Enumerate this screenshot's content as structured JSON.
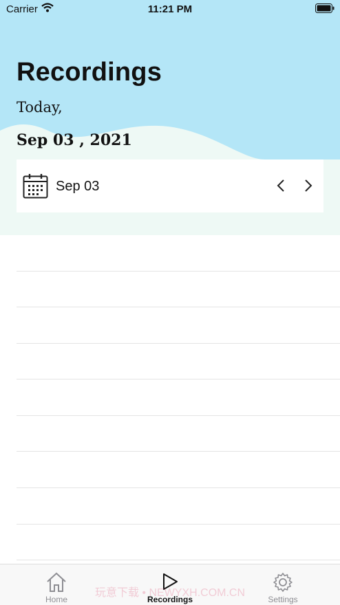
{
  "status_bar": {
    "carrier": "Carrier",
    "time": "11:21 PM"
  },
  "header": {
    "title": "Recordings",
    "today_label": "Today,",
    "date": "Sep 03 , 2021"
  },
  "date_picker": {
    "label": "Sep 03"
  },
  "list": {
    "row_count": 9
  },
  "tab_bar": {
    "home": "Home",
    "recordings": "Recordings",
    "settings": "Settings"
  },
  "watermark": "玩意下载 • NEWYXH.COM.CN",
  "colors": {
    "sky": "#b4e6f7",
    "mint": "#eef9f5",
    "active_tab": "#111111",
    "inactive_tab": "#8e8e93"
  }
}
